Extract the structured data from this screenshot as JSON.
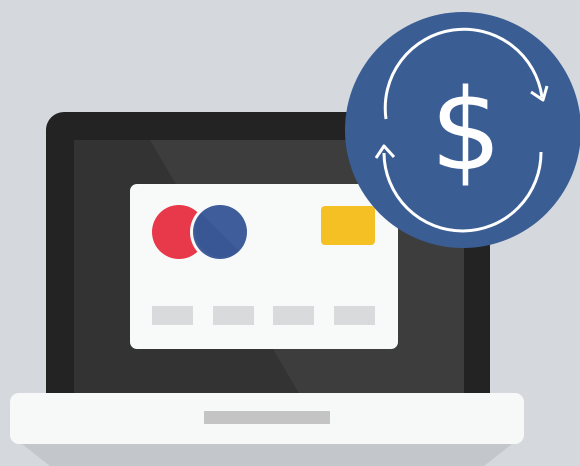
{
  "colors": {
    "background": "#d5d8dc",
    "laptop_bezel": "#232323",
    "laptop_screen": "#383838",
    "laptop_base": "#f7f8f8",
    "card_body": "#f8f9f9",
    "card_circle_red": "#e8394b",
    "card_circle_blue": "#3f5d9b",
    "card_chip": "#f5c024",
    "card_number_blocks": "#d9dadb",
    "badge_fill": "#3a5d93",
    "badge_ring": "#ffffff"
  },
  "badge": {
    "symbol": "$",
    "icon_name": "currency-exchange-icon"
  },
  "card": {
    "icon_name": "credit-card-icon",
    "number_blocks": 4
  },
  "laptop": {
    "icon_name": "laptop-icon"
  }
}
